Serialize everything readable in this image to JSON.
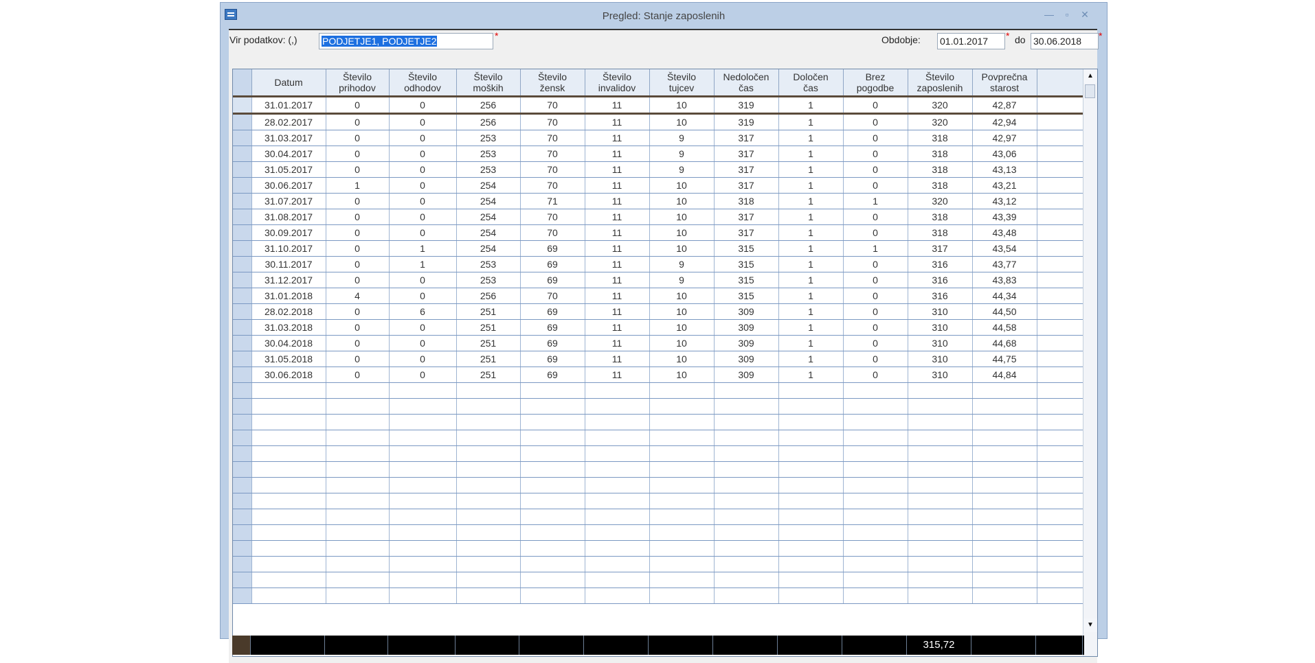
{
  "window": {
    "title": "Pregled: Stanje zaposlenih",
    "icons": [
      "app-icon",
      "minimize-icon",
      "maximize-icon",
      "close-icon"
    ]
  },
  "toolbar": {
    "source_label": "Vir podatkov: (,)",
    "source_value": "PODJETJE1, PODJETJE2",
    "required_mark": "*",
    "period_label": "Obdobje:",
    "date_from": "01.01.2017",
    "to_label": "do",
    "date_to": "30.06.2018"
  },
  "table": {
    "headers": [
      "Datum",
      "Število\nprihodov",
      "Število\nodhodov",
      "Število\nmoških",
      "Število\nžensk",
      "Število\ninvalidov",
      "Število\ntujcev",
      "Nedoločen\nčas",
      "Določen\nčas",
      "Brez\npogodbe",
      "Število\nzaposlenih",
      "Povprečna\nstarost"
    ],
    "rows": [
      [
        "31.01.2017",
        "0",
        "0",
        "256",
        "70",
        "11",
        "10",
        "319",
        "1",
        "0",
        "320",
        "42,87"
      ],
      [
        "28.02.2017",
        "0",
        "0",
        "256",
        "70",
        "11",
        "10",
        "319",
        "1",
        "0",
        "320",
        "42,94"
      ],
      [
        "31.03.2017",
        "0",
        "0",
        "253",
        "70",
        "11",
        "9",
        "317",
        "1",
        "0",
        "318",
        "42,97"
      ],
      [
        "30.04.2017",
        "0",
        "0",
        "253",
        "70",
        "11",
        "9",
        "317",
        "1",
        "0",
        "318",
        "43,06"
      ],
      [
        "31.05.2017",
        "0",
        "0",
        "253",
        "70",
        "11",
        "9",
        "317",
        "1",
        "0",
        "318",
        "43,13"
      ],
      [
        "30.06.2017",
        "1",
        "0",
        "254",
        "70",
        "11",
        "10",
        "317",
        "1",
        "0",
        "318",
        "43,21"
      ],
      [
        "31.07.2017",
        "0",
        "0",
        "254",
        "71",
        "11",
        "10",
        "318",
        "1",
        "1",
        "320",
        "43,12"
      ],
      [
        "31.08.2017",
        "0",
        "0",
        "254",
        "70",
        "11",
        "10",
        "317",
        "1",
        "0",
        "318",
        "43,39"
      ],
      [
        "30.09.2017",
        "0",
        "0",
        "254",
        "70",
        "11",
        "10",
        "317",
        "1",
        "0",
        "318",
        "43,48"
      ],
      [
        "31.10.2017",
        "0",
        "1",
        "254",
        "69",
        "11",
        "10",
        "315",
        "1",
        "1",
        "317",
        "43,54"
      ],
      [
        "30.11.2017",
        "0",
        "1",
        "253",
        "69",
        "11",
        "9",
        "315",
        "1",
        "0",
        "316",
        "43,77"
      ],
      [
        "31.12.2017",
        "0",
        "0",
        "253",
        "69",
        "11",
        "9",
        "315",
        "1",
        "0",
        "316",
        "43,83"
      ],
      [
        "31.01.2018",
        "4",
        "0",
        "256",
        "70",
        "11",
        "10",
        "315",
        "1",
        "0",
        "316",
        "44,34"
      ],
      [
        "28.02.2018",
        "0",
        "6",
        "251",
        "69",
        "11",
        "10",
        "309",
        "1",
        "0",
        "310",
        "44,50"
      ],
      [
        "31.03.2018",
        "0",
        "0",
        "251",
        "69",
        "11",
        "10",
        "309",
        "1",
        "0",
        "310",
        "44,58"
      ],
      [
        "30.04.2018",
        "0",
        "0",
        "251",
        "69",
        "11",
        "10",
        "309",
        "1",
        "0",
        "310",
        "44,68"
      ],
      [
        "31.05.2018",
        "0",
        "0",
        "251",
        "69",
        "11",
        "10",
        "309",
        "1",
        "0",
        "310",
        "44,75"
      ],
      [
        "30.06.2018",
        "0",
        "0",
        "251",
        "69",
        "11",
        "10",
        "309",
        "1",
        "0",
        "310",
        "44,84"
      ]
    ],
    "empty_rows": 14,
    "footer_total": "315,72"
  },
  "scrollbar": {
    "up": "▲",
    "down": "▼"
  }
}
